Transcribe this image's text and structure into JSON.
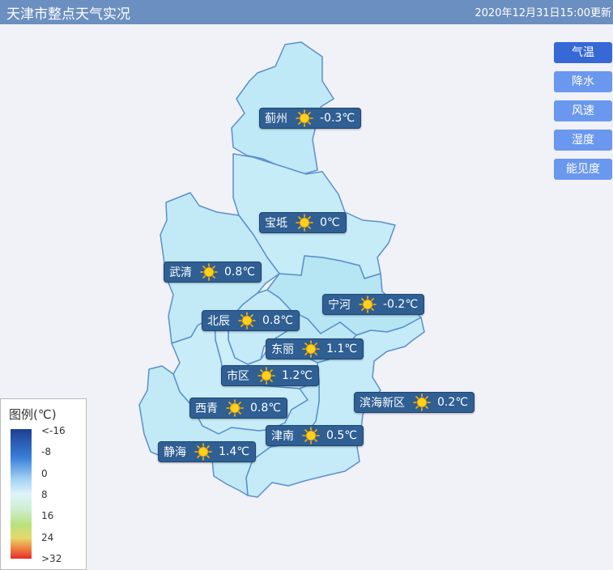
{
  "header": {
    "title": "天津市整点天气实况",
    "update_time": "2020年12月31日15:00更新"
  },
  "buttons": [
    {
      "label": "气温",
      "active": true
    },
    {
      "label": "降水",
      "active": false
    },
    {
      "label": "风速",
      "active": false
    },
    {
      "label": "湿度",
      "active": false
    },
    {
      "label": "能见度",
      "active": false
    }
  ],
  "stations": [
    {
      "name": "蓟州",
      "temp": "-0.3℃",
      "icon": "sunny-icon"
    },
    {
      "name": "宝坻",
      "temp": "0℃",
      "icon": "sunny-icon"
    },
    {
      "name": "武清",
      "temp": "0.8℃",
      "icon": "sunny-icon"
    },
    {
      "name": "宁河",
      "temp": "-0.2℃",
      "icon": "sunny-icon"
    },
    {
      "name": "北辰",
      "temp": "0.8℃",
      "icon": "sunny-icon"
    },
    {
      "name": "东丽",
      "temp": "1.1℃",
      "icon": "sunny-icon"
    },
    {
      "name": "市区",
      "temp": "1.2℃",
      "icon": "sunny-icon"
    },
    {
      "name": "滨海新区",
      "temp": "0.2℃",
      "icon": "sunny-icon"
    },
    {
      "name": "西青",
      "temp": "0.8℃",
      "icon": "sunny-icon"
    },
    {
      "name": "津南",
      "temp": "0.5℃",
      "icon": "sunny-icon"
    },
    {
      "name": "静海",
      "temp": "1.4℃",
      "icon": "sunny-icon"
    }
  ],
  "legend": {
    "title": "图例(℃)",
    "ticks": [
      "<-16",
      "-8",
      "0",
      "8",
      "16",
      "24",
      ">32"
    ],
    "colors": [
      "#1d3f91",
      "#3a7fd8",
      "#9fd0f2",
      "#dff3fb",
      "#b8e27a",
      "#ee7a3c",
      "#e52b2b"
    ]
  },
  "colors": {
    "header_bg": "#6b8fc0",
    "active_button": "#3769d6",
    "button": "#6a98ee",
    "label_bg": "#2f5f93",
    "map_fill": "#bde8f5",
    "border": "#5b8fcc"
  }
}
